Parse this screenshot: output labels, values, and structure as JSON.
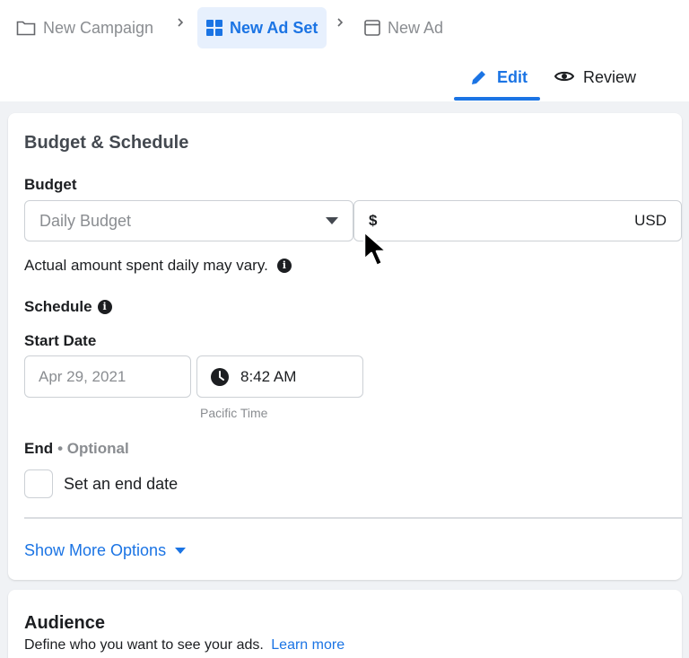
{
  "breadcrumb": {
    "campaign": "New Campaign",
    "adset": "New Ad Set",
    "ad": "New Ad"
  },
  "tabs": {
    "edit": "Edit",
    "review": "Review"
  },
  "budget_schedule": {
    "title": "Budget & Schedule",
    "budget_label": "Budget",
    "budget_type_placeholder": "Daily Budget",
    "currency_symbol": "$",
    "currency_code": "USD",
    "budget_note": "Actual amount spent daily may vary.",
    "schedule_label": "Schedule",
    "start_date_label": "Start Date",
    "start_date_value": "Apr 29, 2021",
    "start_time_value": "8:42 AM",
    "timezone": "Pacific Time",
    "end_label": "End",
    "end_optional": "• Optional",
    "end_checkbox_label": "Set an end date",
    "end_checkbox_checked": false,
    "more_options": "Show More Options"
  },
  "audience": {
    "title": "Audience",
    "description": "Define who you want to see your ads.",
    "learn_more": "Learn more"
  },
  "icons": {
    "campaign": "folder-icon",
    "adset": "grid-icon",
    "ad": "ad-frame-icon",
    "edit": "pencil-icon",
    "review": "eye-icon",
    "time": "clock-icon",
    "info": "info-icon",
    "dropdown": "caret-down-icon",
    "cursor": "mouse-pointer-icon"
  },
  "colors": {
    "accent": "#1b74e4",
    "active_bg": "#e7f0fd",
    "page_bg": "#f0f2f5"
  }
}
